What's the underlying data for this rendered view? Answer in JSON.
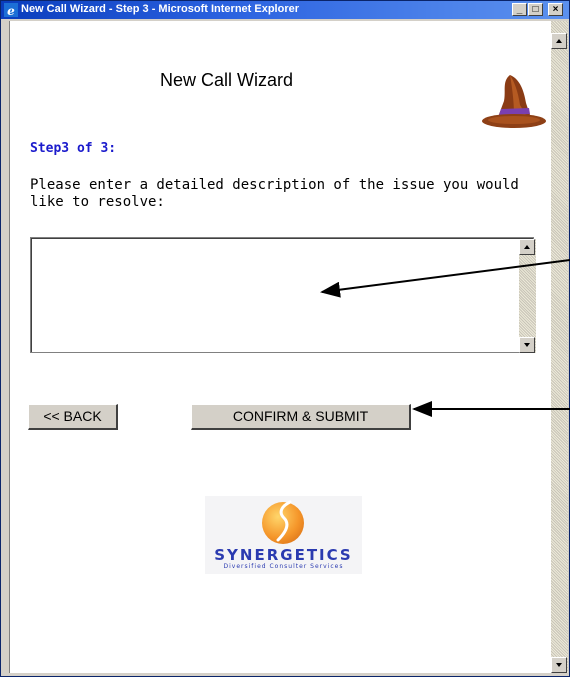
{
  "window": {
    "title": "New Call Wizard - Step 3 - Microsoft Internet Explorer",
    "min_label": "_",
    "max_label": "□",
    "close_label": "×"
  },
  "page": {
    "heading": "New Call Wizard",
    "step_label": "Step3 of 3:",
    "prompt": "Please enter a detailed description of the issue you would like to resolve:",
    "description_value": ""
  },
  "buttons": {
    "back_label": "<< BACK",
    "submit_label": "CONFIRM & SUBMIT"
  },
  "logo": {
    "name": "SYNERGETICS",
    "tagline": "Diversified Consulter Services"
  },
  "colors": {
    "step_label": "#1a1acc",
    "titlebar": "#0a3dbd",
    "logo_text": "#2a3ab0"
  },
  "icons": [
    "internet-explorer-icon",
    "wizard-hat-icon",
    "synergetics-logo-icon"
  ]
}
